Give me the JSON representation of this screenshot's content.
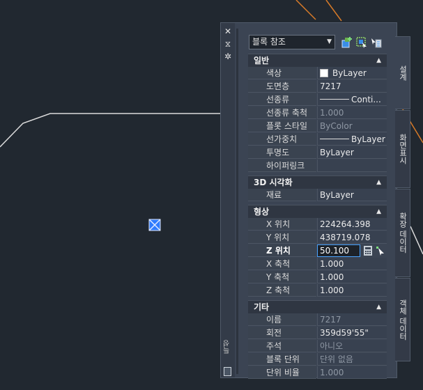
{
  "palette": {
    "strip_title": "특성",
    "object_type": "블록 참조",
    "sections": {
      "general": {
        "title": "일반",
        "rows": [
          {
            "name": "색상",
            "value": "ByLayer"
          },
          {
            "name": "도면층",
            "value": "7217"
          },
          {
            "name": "선종류",
            "value": "Conti..."
          },
          {
            "name": "선종류 축척",
            "value": "1.000"
          },
          {
            "name": "플롯 스타일",
            "value": "ByColor"
          },
          {
            "name": "선가중치",
            "value": "ByLayer"
          },
          {
            "name": "투명도",
            "value": "ByLayer"
          },
          {
            "name": "하이퍼링크",
            "value": ""
          }
        ]
      },
      "visual3d": {
        "title": "3D 시각화",
        "rows": [
          {
            "name": "재료",
            "value": "ByLayer"
          }
        ]
      },
      "geometry": {
        "title": "형상",
        "rows": [
          {
            "name": "X 위치",
            "value": "224264.398"
          },
          {
            "name": "Y 위치",
            "value": "438719.078"
          },
          {
            "name": "Z 위치",
            "value": "50.100"
          },
          {
            "name": "X 축척",
            "value": "1.000"
          },
          {
            "name": "Y 축척",
            "value": "1.000"
          },
          {
            "name": "Z 축척",
            "value": "1.000"
          }
        ]
      },
      "misc": {
        "title": "기타",
        "rows": [
          {
            "name": "이름",
            "value": "7217"
          },
          {
            "name": "회전",
            "value": "359d59'55\""
          },
          {
            "name": "주석",
            "value": "아니오"
          },
          {
            "name": "블록 단위",
            "value": "단위 없음"
          },
          {
            "name": "단위 비율",
            "value": "1.000"
          }
        ]
      }
    },
    "side_tabs": [
      "설계",
      "화면표시",
      "확장 데이터",
      "객체 데이터"
    ]
  },
  "colors": {
    "background": "#212830",
    "panel": "#3b4453",
    "accent": "#4aa3ff",
    "drawing_line": "#dcdcdc",
    "orange_line": "#d77a28"
  }
}
